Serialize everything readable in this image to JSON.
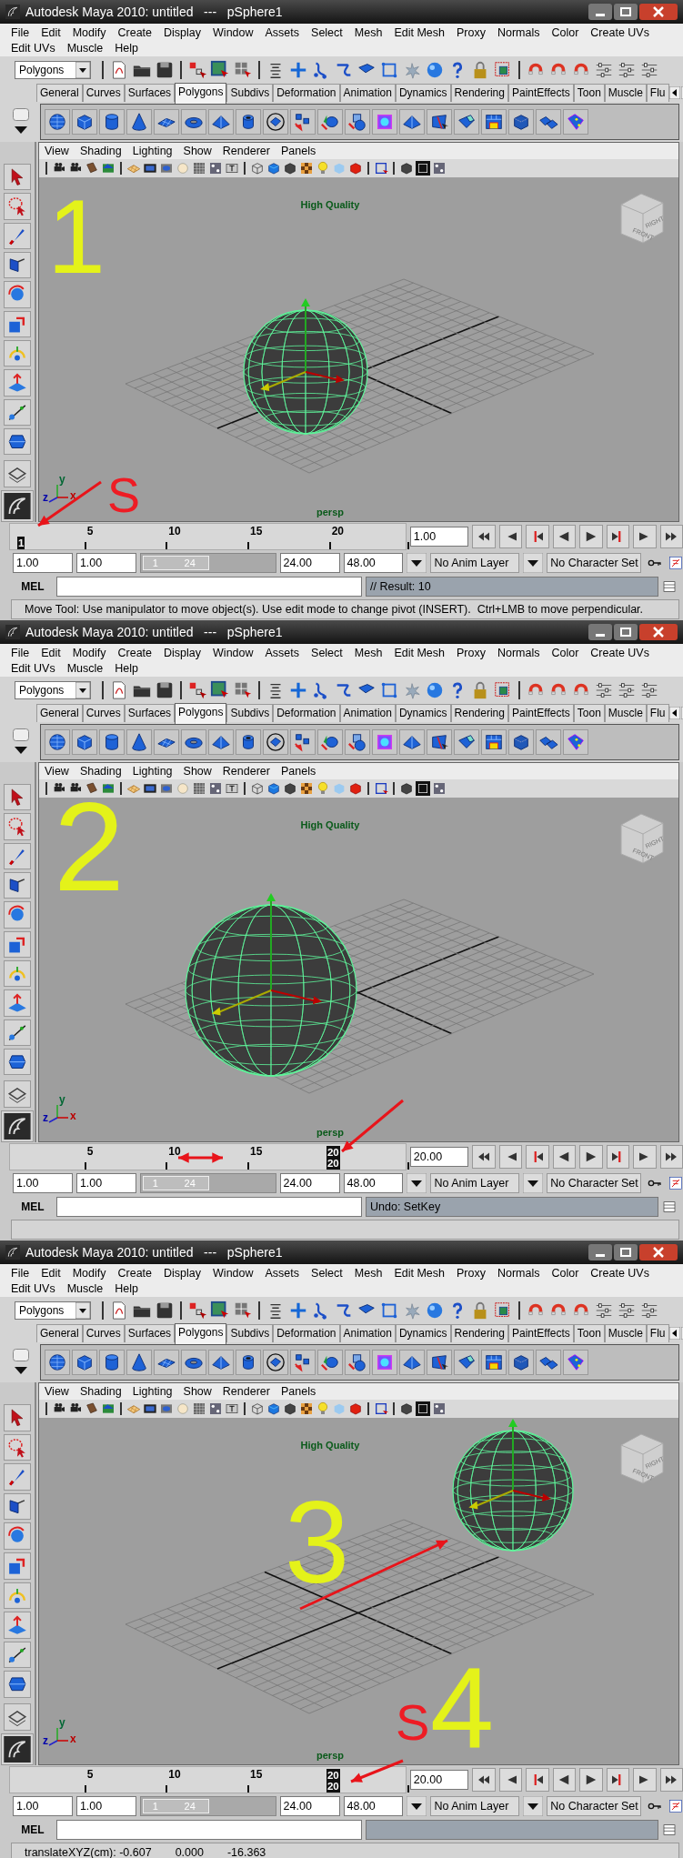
{
  "panels": [
    {
      "title": "Autodesk Maya 2010: untitled   ---   pSphere1",
      "menus": [
        "File",
        "Edit",
        "Modify",
        "Create",
        "Display",
        "Window",
        "Assets",
        "Select",
        "Mesh",
        "Edit Mesh",
        "Proxy",
        "Normals",
        "Color",
        "Create UVs",
        "Edit UVs",
        "Muscle",
        "Help"
      ],
      "mode": "Polygons",
      "shelf_tabs": [
        {
          "label": "General",
          "selected": false
        },
        {
          "label": "Curves",
          "selected": false
        },
        {
          "label": "Surfaces",
          "selected": false
        },
        {
          "label": "Polygons",
          "selected": true
        },
        {
          "label": "Subdivs",
          "selected": false
        },
        {
          "label": "Deformation",
          "selected": false
        },
        {
          "label": "Animation",
          "selected": false
        },
        {
          "label": "Dynamics",
          "selected": false
        },
        {
          "label": "Rendering",
          "selected": false
        },
        {
          "label": "PaintEffects",
          "selected": false
        },
        {
          "label": "Toon",
          "selected": false
        },
        {
          "label": "Muscle",
          "selected": false
        },
        {
          "label": "Flu",
          "selected": false
        }
      ],
      "viewport_menus": [
        "View",
        "Shading",
        "Lighting",
        "Show",
        "Renderer",
        "Panels"
      ],
      "quality_label": "High Quality",
      "view_cube": [
        "FRONT",
        "RIGHT"
      ],
      "axis_labels": [
        "y",
        "z",
        "x"
      ],
      "camera": "persp",
      "annotations": [
        {
          "kind": "number",
          "text": "1"
        },
        {
          "kind": "letter",
          "text": "S"
        },
        {
          "kind": "arrow"
        }
      ],
      "timeline": {
        "ticks": [
          "5",
          "10",
          "15",
          "20"
        ],
        "current_marker": [
          "1"
        ],
        "level": 0,
        "current_frame": "1.00"
      },
      "range": {
        "start": "1.00",
        "inner_start": "1.00",
        "slider_labels": [
          "1",
          "24"
        ],
        "level": 0.5,
        "inner_end": "24.00",
        "end": "48.00"
      },
      "anim_layer": "No Anim Layer",
      "character_set": "No Character Set",
      "mel_label": "MEL",
      "result": "// Result: 10",
      "help_line": [
        "Move Tool: Use manipulator to move object(s). Use edit mode to change pivot (INSERT).  Ctrl+LMB to move perpendicular."
      ]
    },
    {
      "title": "Autodesk Maya 2010: untitled   ---   pSphere1",
      "menus": [
        "File",
        "Edit",
        "Modify",
        "Create",
        "Display",
        "Window",
        "Assets",
        "Select",
        "Mesh",
        "Edit Mesh",
        "Proxy",
        "Normals",
        "Color",
        "Create UVs",
        "Edit UVs",
        "Muscle",
        "Help"
      ],
      "mode": "Polygons",
      "shelf_tabs": [
        {
          "label": "General",
          "selected": false
        },
        {
          "label": "Curves",
          "selected": false
        },
        {
          "label": "Surfaces",
          "selected": false
        },
        {
          "label": "Polygons",
          "selected": true
        },
        {
          "label": "Subdivs",
          "selected": false
        },
        {
          "label": "Deformation",
          "selected": false
        },
        {
          "label": "Animation",
          "selected": false
        },
        {
          "label": "Dynamics",
          "selected": false
        },
        {
          "label": "Rendering",
          "selected": false
        },
        {
          "label": "PaintEffects",
          "selected": false
        },
        {
          "label": "Toon",
          "selected": false
        },
        {
          "label": "Muscle",
          "selected": false
        },
        {
          "label": "Flu",
          "selected": false
        }
      ],
      "viewport_menus": [
        "View",
        "Shading",
        "Lighting",
        "Show",
        "Renderer",
        "Panels"
      ],
      "quality_label": "High Quality",
      "view_cube": [
        "FRONT",
        "RIGHT"
      ],
      "axis_labels": [
        "y",
        "z",
        "x"
      ],
      "camera": "persp",
      "annotations": [
        {
          "kind": "number",
          "text": "2"
        },
        {
          "kind": "arrow"
        },
        {
          "kind": "double-arrow"
        }
      ],
      "timeline": {
        "ticks": [
          "5",
          "10",
          "15"
        ],
        "current_marker": [
          "20",
          "20"
        ],
        "level": 0.79,
        "current_frame": "20.00"
      },
      "range": {
        "start": "1.00",
        "inner_start": "1.00",
        "slider_labels": [
          "1",
          "24"
        ],
        "level": 0.5,
        "inner_end": "24.00",
        "end": "48.00"
      },
      "anim_layer": "No Anim Layer",
      "character_set": "No Character Set",
      "mel_label": "MEL",
      "result": "Undo: SetKey"
    },
    {
      "title": "Autodesk Maya 2010: untitled   ---   pSphere1",
      "menus": [
        "File",
        "Edit",
        "Modify",
        "Create",
        "Display",
        "Window",
        "Assets",
        "Select",
        "Mesh",
        "Edit Mesh",
        "Proxy",
        "Normals",
        "Color",
        "Create UVs",
        "Edit UVs",
        "Muscle",
        "Help"
      ],
      "mode": "Polygons",
      "shelf_tabs": [
        {
          "label": "General",
          "selected": false
        },
        {
          "label": "Curves",
          "selected": false
        },
        {
          "label": "Surfaces",
          "selected": false
        },
        {
          "label": "Polygons",
          "selected": true
        },
        {
          "label": "Subdivs",
          "selected": false
        },
        {
          "label": "Deformation",
          "selected": false
        },
        {
          "label": "Animation",
          "selected": false
        },
        {
          "label": "Dynamics",
          "selected": false
        },
        {
          "label": "Rendering",
          "selected": false
        },
        {
          "label": "PaintEffects",
          "selected": false
        },
        {
          "label": "Toon",
          "selected": false
        },
        {
          "label": "Muscle",
          "selected": false
        },
        {
          "label": "Flu",
          "selected": false
        }
      ],
      "viewport_menus": [
        "View",
        "Shading",
        "Lighting",
        "Show",
        "Renderer",
        "Panels"
      ],
      "quality_label": "High Quality",
      "view_cube": [
        "FRONT",
        "RIGHT"
      ],
      "axis_labels": [
        "y",
        "z",
        "x"
      ],
      "camera": "persp",
      "annotations": [
        {
          "kind": "number",
          "text": "3"
        },
        {
          "kind": "arrow"
        },
        {
          "kind": "letter",
          "text": "S"
        },
        {
          "kind": "number",
          "text": "4"
        },
        {
          "kind": "arrow"
        }
      ],
      "timeline": {
        "ticks": [
          "5",
          "10",
          "15"
        ],
        "current_marker": [
          "20",
          "20"
        ],
        "level": 0.79,
        "current_frame": "20.00"
      },
      "range": {
        "start": "1.00",
        "inner_start": "1.00",
        "slider_labels": [
          "1",
          "24"
        ],
        "level": 0.5,
        "inner_end": "24.00",
        "end": "48.00"
      },
      "anim_layer": "No Anim Layer",
      "character_set": "No Character Set",
      "mel_label": "MEL",
      "help_line": [
        "translateXYZ(cm): -0.607",
        "0.000",
        "-16.363"
      ]
    }
  ]
}
